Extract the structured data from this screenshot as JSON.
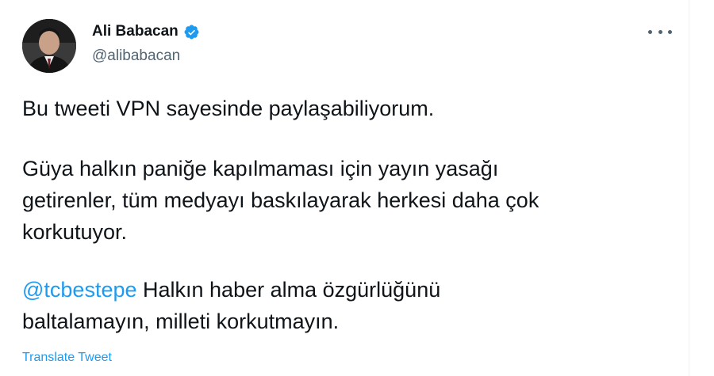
{
  "author": {
    "name": "Ali Babacan",
    "handle": "@alibabacan",
    "verified": true
  },
  "tweet": {
    "paragraph1": "Bu tweeti VPN sayesinde paylaşabiliyorum.",
    "paragraph2_line1": "Güya halkın paniğe kapılmaması için yayın yasağı",
    "paragraph2_line2": "getirenler, tüm medyayı baskılayarak herkesi daha çok",
    "paragraph2_line3": "korkutuyor.",
    "mention": "@tcbestepe",
    "paragraph3_rest1": " Halkın haber alma özgürlüğünü",
    "paragraph3_line2": "baltalamayın, milleti korkutmayın."
  },
  "actions": {
    "translate_label": "Translate Tweet",
    "more_icon": "more-horizontal-icon"
  },
  "colors": {
    "link": "#1d9bf0",
    "text": "#0f1419",
    "muted": "#536471"
  }
}
